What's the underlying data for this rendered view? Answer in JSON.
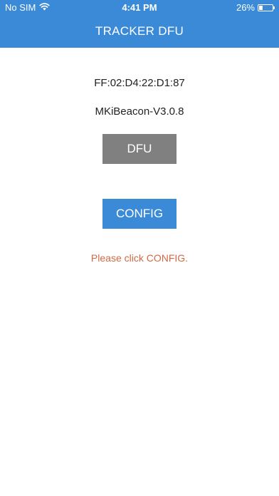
{
  "status_bar": {
    "carrier": "No SIM",
    "time": "4:41 PM",
    "battery": "26%",
    "battery_level": 0.26,
    "wifi_icon": "wifi-icon",
    "battery_icon": "battery-icon"
  },
  "header": {
    "title": "TRACKER DFU",
    "color": "#3a8ad8"
  },
  "device": {
    "mac_address": "FF:02:D4:22:D1:87",
    "firmware": "MKiBeacon-V3.0.8"
  },
  "buttons": {
    "dfu_label": "DFU",
    "dfu_color": "#808080",
    "config_label": "CONFIG",
    "config_color": "#3a8ad8"
  },
  "message": {
    "text": "Please click CONFIG.",
    "color": "#d06a43"
  }
}
